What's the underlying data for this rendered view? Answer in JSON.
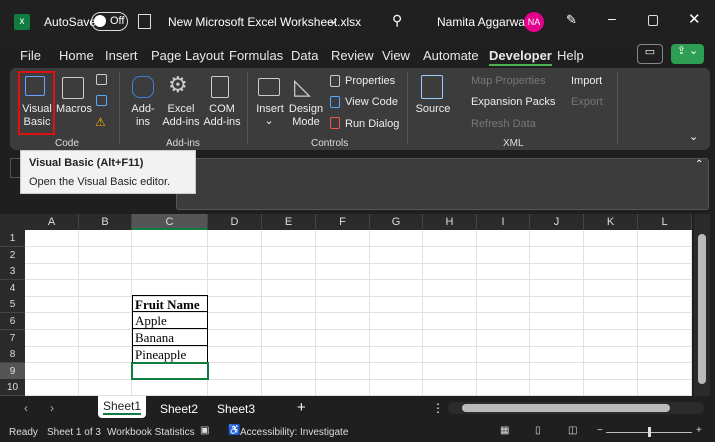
{
  "titlebar": {
    "autosave_label": "AutoSave",
    "autosave_state": "Off",
    "filename": "New Microsoft Excel Worksheet.xlsx",
    "user": "Namita Aggarwal",
    "initials": "NA",
    "avatar_color": "#e3008c"
  },
  "menu": [
    "File",
    "Home",
    "Insert",
    "Page Layout",
    "Formulas",
    "Data",
    "Review",
    "View",
    "Automate",
    "Developer",
    "Help"
  ],
  "active_tab": "Developer",
  "ribbon": {
    "code": {
      "label": "Code",
      "visual_basic": "Visual\nBasic",
      "macros": "Macros"
    },
    "addins": {
      "label": "Add-ins",
      "addins": "Add-\nins",
      "excel_addins": "Excel\nAdd-ins",
      "com_addins": "COM\nAdd-ins"
    },
    "controls": {
      "label": "Controls",
      "insert": "Insert",
      "design_mode": "Design\nMode",
      "properties": "Properties",
      "view_code": "View Code",
      "run_dialog": "Run Dialog"
    },
    "xml": {
      "label": "XML",
      "source": "Source",
      "map_properties": "Map Properties",
      "expansion_packs": "Expansion Packs",
      "refresh_data": "Refresh Data",
      "import": "Import",
      "export": "Export"
    }
  },
  "tooltip": {
    "title": "Visual Basic (Alt+F11)",
    "description": "Open the Visual Basic editor."
  },
  "columns": [
    "A",
    "B",
    "C",
    "D",
    "E",
    "F",
    "G",
    "H",
    "I",
    "J",
    "K",
    "L"
  ],
  "rows": [
    "1",
    "2",
    "3",
    "4",
    "5",
    "6",
    "7",
    "8",
    "9",
    "10"
  ],
  "cells": {
    "C5": "Fruit Name",
    "C6": "Apple",
    "C7": "Banana",
    "C8": "Pineapple"
  },
  "sheets": [
    "Sheet1",
    "Sheet2",
    "Sheet3"
  ],
  "active_sheet": "Sheet1",
  "status": {
    "ready": "Ready",
    "sheet_of": "Sheet 1 of 3",
    "workbook_stats": "Workbook Statistics",
    "accessibility": "Accessibility: Investigate"
  }
}
